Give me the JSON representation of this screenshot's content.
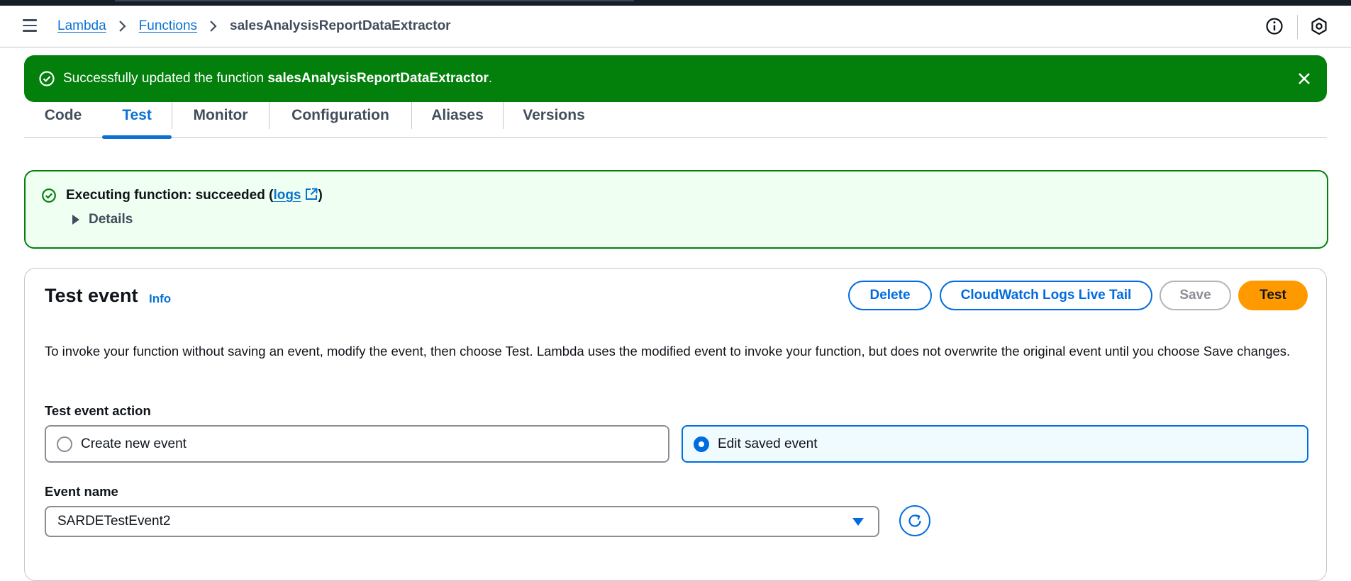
{
  "breadcrumb": {
    "items": [
      "Lambda",
      "Functions"
    ],
    "current": "salesAnalysisReportDataExtractor"
  },
  "header_icons": [
    "info-icon",
    "settings-hexagon-icon"
  ],
  "flash": {
    "prefix": "Successfully updated the function ",
    "function_name": "salesAnalysisReportDataExtractor",
    "suffix": ".",
    "color": "#037f0c"
  },
  "tabs": [
    {
      "label": "Code",
      "active": false
    },
    {
      "label": "Test",
      "active": true
    },
    {
      "label": "Monitor",
      "active": false
    },
    {
      "label": "Configuration",
      "active": false
    },
    {
      "label": "Aliases",
      "active": false
    },
    {
      "label": "Versions",
      "active": false
    }
  ],
  "result": {
    "prefix": "Executing function: succeeded (",
    "link": "logs",
    "suffix": ")",
    "details_label": "Details"
  },
  "test_event": {
    "title": "Test event",
    "info": "Info",
    "buttons": {
      "delete": "Delete",
      "live_tail": "CloudWatch Logs Live Tail",
      "save": "Save",
      "test": "Test"
    },
    "description": "To invoke your function without saving an event, modify the event, then choose Test. Lambda uses the modified event to invoke your function, but does not overwrite the original event until you choose Save changes.",
    "action_label": "Test event action",
    "options": [
      {
        "label": "Create new event",
        "selected": false
      },
      {
        "label": "Edit saved event",
        "selected": true
      }
    ],
    "event_name_label": "Event name",
    "event_name_value": "SARDETestEvent2"
  },
  "colors": {
    "link": "#0972d3",
    "primary_button": "#ff9900",
    "success": "#037f0c"
  }
}
